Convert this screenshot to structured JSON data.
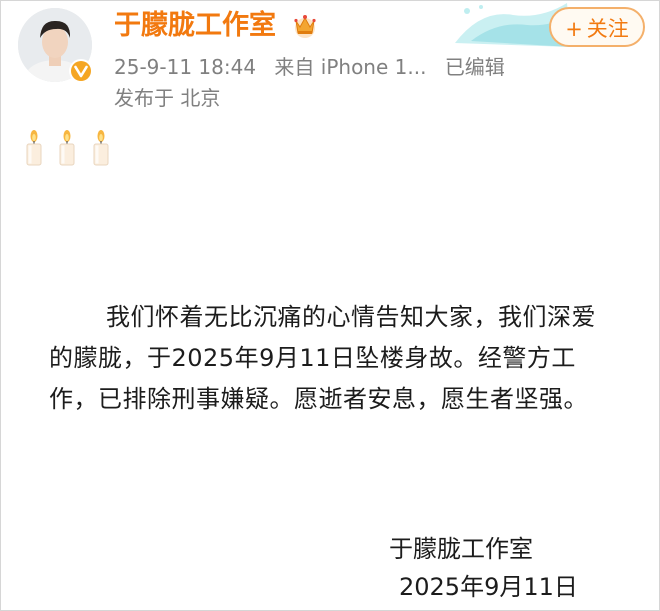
{
  "post": {
    "author": "于朦胧工作室",
    "timestamp": "25-9-11 18:44",
    "source": "来自 iPhone 1...",
    "edited": "已编辑",
    "location": "发布于 北京",
    "follow_label": "关注",
    "body": "我们怀着无比沉痛的心情告知大家，我们深爱的朦胧，于2025年9月11日坠楼身故。经警方工作，已排除刑事嫌疑。愿逝者安息，愿生者坚强。",
    "signature": "于朦胧工作室",
    "signature_date": "2025年9月11日"
  },
  "icons": {
    "avatar": "avatar",
    "verified": "verified-badge-icon",
    "crown": "crown-icon",
    "candles": [
      "candle-icon",
      "candle-icon",
      "candle-icon"
    ],
    "plus": "plus-icon"
  },
  "colors": {
    "author": "#f2790f",
    "meta": "#808080",
    "follow_border": "#f4b06b",
    "verified": "#f5a623",
    "body_text": "#1c1c1c"
  }
}
